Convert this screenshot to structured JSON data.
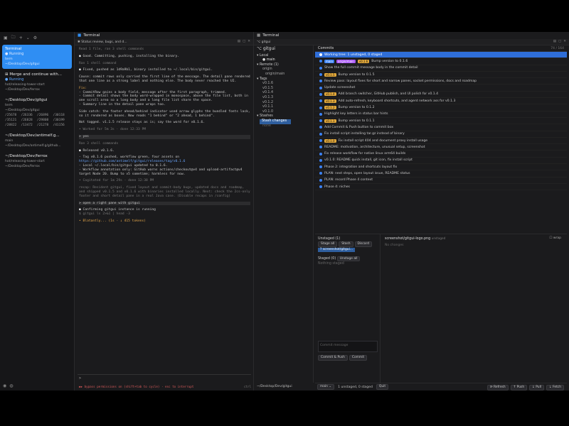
{
  "sidebar": {
    "sessions": [
      {
        "title": "Terminal",
        "status": "Running",
        "sub1": "term",
        "sub2": "~/Desktop/Dev/gitgui"
      },
      {
        "title": "Merge and continue with...",
        "status": "Running",
        "sub1": "hot/releasing-tower-start",
        "sub2": "~/Desktop/Dev/ferrox"
      },
      {
        "title": "~/Desktop/Dev/gitgui",
        "sub1": "term",
        "sub2": "~/Desktop/Dev/gitgui",
        "grid": [
          "/25678",
          "/26336",
          "/26896",
          "/30118",
          "/35121",
          "/26828",
          "/29808",
          "/30199",
          "/28822",
          "/13472",
          "/21278",
          "/41156"
        ]
      },
      {
        "title": "~/Desktop/Dev/antimelf.g...",
        "sub1": "main",
        "sub2": "~/Desktop/Dev/antimelf.g/github..."
      },
      {
        "title": "~/Desktop/Dev/ferrox",
        "sub1": "hot/releasing-tower-start",
        "sub2": "~/Desktop/Dev/ferrox"
      }
    ]
  },
  "pane1": {
    "title": "Terminal",
    "tab": "Status review, bugs, and d...",
    "lines": {
      "l1": "Read 1 file, ran 3 shell commands",
      "l2": "Good. Committing, pushing, installing the binary.",
      "l3": "Ran 1 shell command",
      "l4": "Fixed, pushed as 1d9a9b1, binary installed to ~/.local/bin/gitgui.",
      "l5": "Cause: commit rows only carried the first line of the message. The detail pane rendered that one line as a strong label and nothing else. The body never reached the UI.",
      "fix": "Fix:",
      "f1": "- CommitRow gains a body field, message after the first paragraph, trimmed.",
      "f2": "- Commit detail shows the body word-wrapped in monospace, above the file list, both in one scroll area so a long body and a long file list share the space.",
      "f3": "- Summary line in the detail pane wraps too.",
      "l6": "Side catch: the footer ahead/behind indicator used arrow glyphs the bundled fonts lack, so it rendered as boxes. Now reads \"1 behind\" or \"2 ahead, 1 behind\".",
      "l7": "Not tagged. v1.1.5 release stays as is; say the word for v0.1.6.",
      "l8": "• Worked for 5m 3s · done 12:33 PM",
      "l9": "yes",
      "l10": "Ran 3 shell commands",
      "l11": "Released v0.1.6.",
      "r1": "- Tag v0.1.6 pushed, workflow green, four assets on",
      "r1b": "https://github.com/antimelf/gitgui/releases/tag/v0.1.6",
      "r2": "- Local ~/.local/bin/gitgui updated to 0.1.6.",
      "r3": "- Workflow annotation only: GitHub warns actions/checkout@v4 and upload-artifact@v4 target Node 20. Bump to v5 sometime; harmless for now.",
      "l12": "• Cogitated for 1m 29s · done 12:38 PM",
      "l13": "recap: Resident gitgui, fixed layout and commit-body bugs, updated docs and roadmap, and shipped v0.1.5 and v0.1.6 with binaries installed locally. Next: check the 2cs-only footer and short detail pane in a real Java case. (Disable recaps in /config)",
      "l14": "open a right pane with gitgui",
      "l15": "Confirming gitgui instance is running",
      "l16": "  $ gitgui ls 2>&1 | head -3",
      "l17": "• Blatantly... (1s · ↓ 415 tokens)",
      "prompt": ">",
      "status": "▶▶ bypass permissions on (shift+tab to cycle) · esc to interrupt",
      "status_right": "ctrl"
    }
  },
  "pane2": {
    "title": "Terminal",
    "tab": "gitgui",
    "left": {
      "local": "Local",
      "main": "main",
      "remote": "Remote (1)",
      "origin": "origin",
      "origin_main": "origin/main",
      "tags": "Tags",
      "tag_list": [
        "v0.1.6",
        "v0.1.5",
        "v0.1.4",
        "v0.1.3",
        "v0.1.2",
        "v0.1.1",
        "v0.1.0"
      ],
      "stashes": "Stashes",
      "stash_sel": "Stash changes",
      "stash_other": "none"
    },
    "commits": {
      "header": "Commits",
      "count": "74 / 164",
      "rows": [
        {
          "msg": "Working tree: 1 unstaged, 0 staged",
          "wt": true,
          "badges": []
        },
        {
          "msg": "Bump version to 0.1.6",
          "badges": [
            "main",
            "origin/main",
            "v0.1.6"
          ]
        },
        {
          "msg": "Show the full commit message body in the commit detail",
          "badges": []
        },
        {
          "msg": "Bump version to 0.1.5",
          "badges": [
            "v0.1.5"
          ]
        },
        {
          "msg": "Review pass: layout fixes for short and narrow panes, socket permissions, docs and roadmap",
          "badges": []
        },
        {
          "msg": "Update screenshot",
          "badges": []
        },
        {
          "msg": "Add branch switcher, GitHub publish, and UI polish for v0.1.4",
          "badges": [
            "v0.1.4"
          ]
        },
        {
          "msg": "Add auto-refresh, keyboard shortcuts, and agent network ass for v0.1.3",
          "badges": [
            "v0.1.3"
          ]
        },
        {
          "msg": "Bump version to 0.1.2",
          "badges": [
            "v0.1.2"
          ]
        },
        {
          "msg": "Highlight key letters in status bar hints",
          "badges": []
        },
        {
          "msg": "Bump version to 0.1.1",
          "badges": [
            "v0.1.1"
          ]
        },
        {
          "msg": "Add Commit & Push button to commit box",
          "badges": []
        },
        {
          "msg": "Fix install script installing tar.gz instead of binary",
          "badges": []
        },
        {
          "msg": "Fix install script 404 and document proxy install usage",
          "badges": [
            "v0.1.0"
          ]
        },
        {
          "msg": "README: motivation, architecture, unusual setup, screenshot",
          "badges": []
        },
        {
          "msg": "Fix release workflow for native linux arm64 builds",
          "badges": []
        },
        {
          "msg": "v0.1.0: README quick install, git icon, fix install script",
          "badges": []
        },
        {
          "msg": "Phase 2: integration and shortcuts layout fix",
          "badges": []
        },
        {
          "msg": "PLAN: next steps, open layout issue, README status",
          "badges": []
        },
        {
          "msg": "PLAN: record Phase 4 context",
          "badges": []
        },
        {
          "msg": "Phase 4: niches",
          "badges": []
        }
      ]
    },
    "changes": {
      "unstaged_label": "Unstaged (1)",
      "btn_stage_all": "Stage all",
      "btn_stash": "Stash",
      "btn_discard": "Discard",
      "file": "? screenshot/gitgui...",
      "staged_label": "Staged (0)",
      "btn_unstage_all": "Unstage all",
      "nothing_staged": "Nothing staged",
      "commit_placeholder": "Commit message",
      "btn_commit_push": "Commit & Push",
      "btn_commit": "Commit",
      "diff_file": "screenshot/gitgui-logo.png",
      "diff_tag": "unstaged",
      "wrap": "wrap",
      "no_changes": "No changes"
    },
    "status": {
      "path": "~/Desktop/Dev/gitgui",
      "branch": "main",
      "summary": "1 unstaged, 0 staged",
      "quit": "Quit",
      "refresh": "Refresh",
      "push": "Push",
      "pull": "Pull",
      "fetch": "Fetch"
    }
  },
  "colors": {
    "accent": "#2f8ef3",
    "tag": "#e2a83a",
    "remote": "#a855f7"
  }
}
